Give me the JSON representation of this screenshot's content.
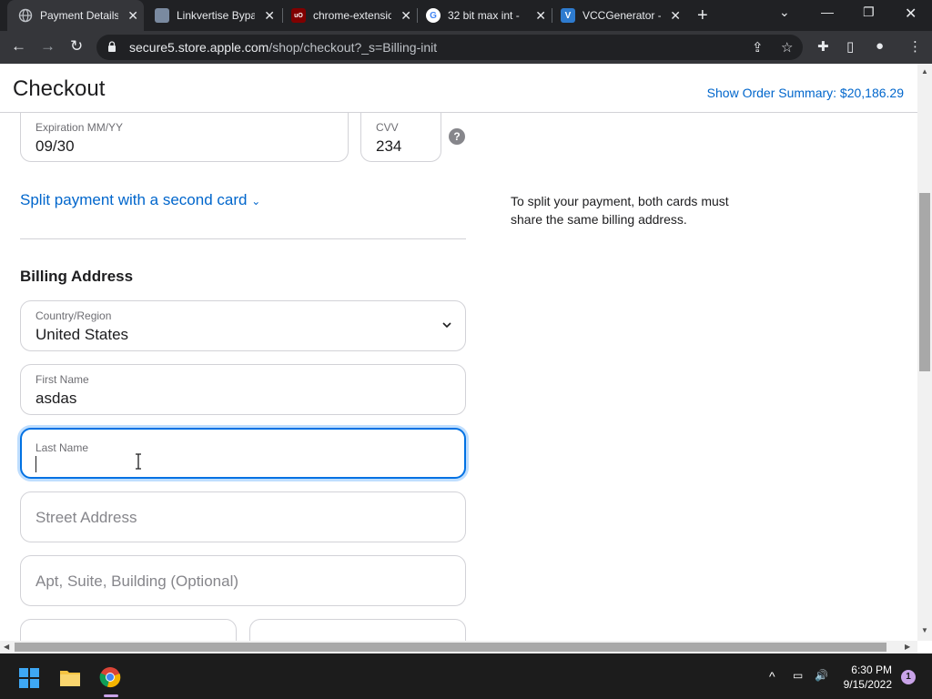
{
  "browser": {
    "tabs": [
      {
        "title": "Payment Details",
        "active": true
      },
      {
        "title": "Linkvertise Bypass"
      },
      {
        "title": "chrome-extension"
      },
      {
        "title": "32 bit max int -"
      },
      {
        "title": "VCCGenerator -"
      }
    ],
    "url_host": "secure5.store.apple.com",
    "url_path": "/shop/checkout?_s=Billing-init"
  },
  "header": {
    "title": "Checkout",
    "order_summary": "Show Order Summary: $20,186.29"
  },
  "payment": {
    "expiration_label": "Expiration MM/YY",
    "expiration_value": "09/30",
    "cvv_label": "CVV",
    "cvv_value": "234",
    "help": "?"
  },
  "split": {
    "link": "Split payment with a second card",
    "note": "To split your payment, both cards must share the same billing address."
  },
  "billing": {
    "title": "Billing Address",
    "country_label": "Country/Region",
    "country_value": "United States",
    "first_name_label": "First Name",
    "first_name_value": "asdas",
    "last_name_label": "Last Name",
    "street_placeholder": "Street Address",
    "apt_placeholder": "Apt, Suite, Building (Optional)"
  },
  "taskbar": {
    "time": "6:30 PM",
    "date": "9/15/2022",
    "notifications": "1"
  },
  "colors": {
    "link": "#0066cc",
    "focus": "#0071e3"
  }
}
